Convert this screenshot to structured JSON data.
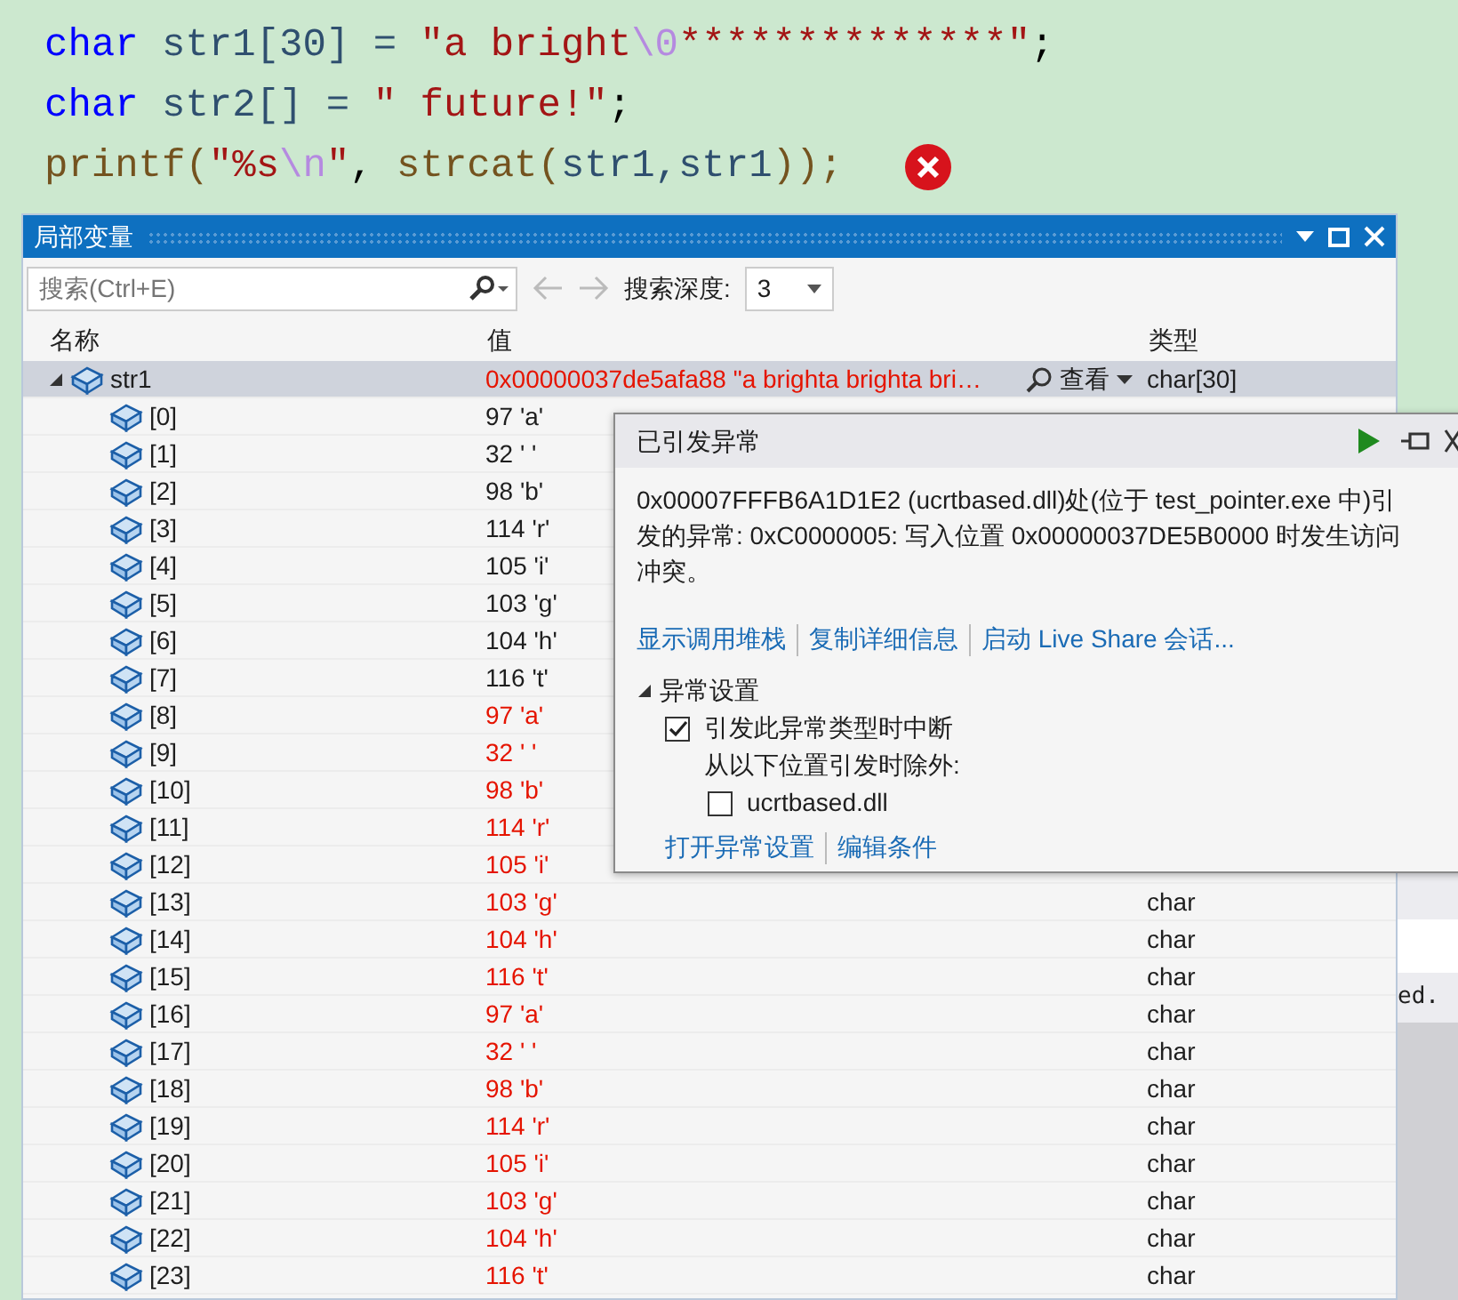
{
  "editor": {
    "lines": [
      {
        "tokens": [
          {
            "kind": "keyword",
            "text": "char"
          },
          {
            "kind": "plain",
            "text": " str1[30] = "
          },
          {
            "kind": "string",
            "text": "\"a bright"
          },
          {
            "kind": "escape",
            "text": "\\0"
          },
          {
            "kind": "string",
            "text": "**************\""
          },
          {
            "kind": "punct",
            "text": ";"
          }
        ]
      },
      {
        "tokens": [
          {
            "kind": "keyword",
            "text": "char"
          },
          {
            "kind": "plain",
            "text": " str2[] = "
          },
          {
            "kind": "string",
            "text": "\" future!\""
          },
          {
            "kind": "punct",
            "text": ";"
          }
        ]
      },
      {
        "tokens": [
          {
            "kind": "function",
            "text": "printf("
          },
          {
            "kind": "string",
            "text": "\"%s"
          },
          {
            "kind": "escape",
            "text": "\\n"
          },
          {
            "kind": "string",
            "text": "\""
          },
          {
            "kind": "punct",
            "text": ", "
          },
          {
            "kind": "function",
            "text": "strcat("
          },
          {
            "kind": "plain",
            "text": "str1,str1"
          },
          {
            "kind": "function",
            "text": "));"
          }
        ]
      }
    ],
    "error_marker": true
  },
  "background": {
    "right_fragments": [
      "ed."
    ]
  },
  "locals": {
    "title": "局部变量",
    "search": {
      "placeholder": "搜索(Ctrl+E)",
      "depth_label": "搜索深度:",
      "depth": "3"
    },
    "columns": [
      "名称",
      "值",
      "类型"
    ],
    "rows": [
      {
        "name": "str1",
        "value": "0x00000037de5afa88 \"a brighta brighta bri…",
        "visualizer": "查看",
        "type": "char[30]",
        "changed": true,
        "selected": true,
        "expanded": true,
        "children": [
          {
            "name": "[0]",
            "value": "97 'a'",
            "changed": false,
            "selected": false
          },
          {
            "name": "[1]",
            "value": "32 ' '",
            "changed": false,
            "selected": false
          },
          {
            "name": "[2]",
            "value": "98 'b'",
            "changed": false,
            "selected": false
          },
          {
            "name": "[3]",
            "value": "114 'r'",
            "changed": false,
            "selected": false
          },
          {
            "name": "[4]",
            "value": "105 'i'",
            "changed": false,
            "selected": false
          },
          {
            "name": "[5]",
            "value": "103 'g'",
            "changed": false,
            "selected": false
          },
          {
            "name": "[6]",
            "value": "104 'h'",
            "changed": false,
            "selected": false
          },
          {
            "name": "[7]",
            "value": "116 't'",
            "changed": false,
            "selected": false
          },
          {
            "name": "[8]",
            "value": "97 'a'",
            "changed": true,
            "selected": false
          },
          {
            "name": "[9]",
            "value": "32 ' '",
            "changed": true,
            "selected": false
          },
          {
            "name": "[10]",
            "value": "98 'b'",
            "changed": true,
            "selected": false
          },
          {
            "name": "[11]",
            "value": "114 'r'",
            "changed": true,
            "selected": false
          },
          {
            "name": "[12]",
            "value": "105 'i'",
            "changed": true,
            "selected": false
          },
          {
            "name": "[13]",
            "value": "103 'g'",
            "type": "char",
            "changed": true,
            "selected": false
          },
          {
            "name": "[14]",
            "value": "104 'h'",
            "type": "char",
            "changed": true,
            "selected": false
          },
          {
            "name": "[15]",
            "value": "116 't'",
            "type": "char",
            "changed": true,
            "selected": false
          },
          {
            "name": "[16]",
            "value": "97 'a'",
            "type": "char",
            "changed": true,
            "selected": false
          },
          {
            "name": "[17]",
            "value": "32 ' '",
            "type": "char",
            "changed": true,
            "selected": false
          },
          {
            "name": "[18]",
            "value": "98 'b'",
            "type": "char",
            "changed": true,
            "selected": false
          },
          {
            "name": "[19]",
            "value": "114 'r'",
            "type": "char",
            "changed": true,
            "selected": false
          },
          {
            "name": "[20]",
            "value": "105 'i'",
            "type": "char",
            "changed": true,
            "selected": false
          },
          {
            "name": "[21]",
            "value": "103 'g'",
            "type": "char",
            "changed": true,
            "selected": false
          },
          {
            "name": "[22]",
            "value": "104 'h'",
            "type": "char",
            "changed": true,
            "selected": false
          },
          {
            "name": "[23]",
            "value": "116 't'",
            "type": "char",
            "changed": true,
            "selected": false
          }
        ]
      }
    ]
  },
  "exception_popup": {
    "title": "已引发异常",
    "message": "0x00007FFFB6A1D1E2 (ucrtbased.dll)处(位于 test_pointer.exe 中)引发的异常: 0xC0000005: 写入位置 0x00000037DE5B0000 时发生访问冲突。",
    "links": [
      "显示调用堆栈",
      "复制详细信息",
      "启动 Live Share 会话..."
    ],
    "settings": {
      "label": "异常设置",
      "expanded": true,
      "break_option": {
        "label": "引发此异常类型时中断",
        "checked": true
      },
      "except_label": "从以下位置引发时除外:",
      "except_items": [
        {
          "label": "ucrtbased.dll",
          "checked": false
        }
      ]
    },
    "bottom_links": [
      "打开异常设置",
      "编辑条件"
    ]
  }
}
